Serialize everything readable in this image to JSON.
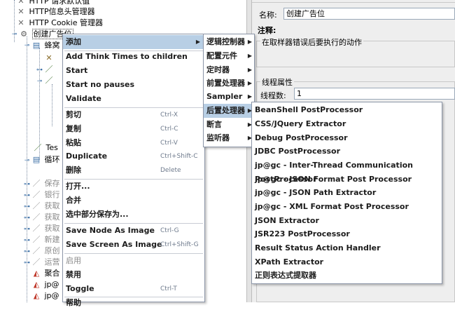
{
  "tree": {
    "items": [
      {
        "label": "HTTP 请求默认值"
      },
      {
        "label": "HTTP信息头管理器"
      },
      {
        "label": "HTTP Cookie 管理器"
      },
      {
        "label": "创建广告位"
      },
      {
        "label": "蜂窝"
      },
      {
        "label": "Tes"
      },
      {
        "label": "循环"
      },
      {
        "label": "保存"
      },
      {
        "label": "银行"
      },
      {
        "label": "获取"
      },
      {
        "label": "获取"
      },
      {
        "label": "获取"
      },
      {
        "label": "新建"
      },
      {
        "label": "原创"
      },
      {
        "label": "运营"
      },
      {
        "label": "聚合"
      },
      {
        "label": "jp@"
      },
      {
        "label": "jp@"
      }
    ]
  },
  "right_panel": {
    "name_label": "名称:",
    "name_value": "创建广告位",
    "comment_label": "注释:",
    "error_action_title": "在取样器错误后要执行的动作",
    "thread_props_title": "线程属性",
    "threads_label": "线程数:",
    "threads_value": "1"
  },
  "context_menu": {
    "add": "添加",
    "add_think_times": "Add Think Times to children",
    "start": "Start",
    "start_no_pauses": "Start no pauses",
    "validate": "Validate",
    "cut": "剪切",
    "cut_sc": "Ctrl-X",
    "copy": "复制",
    "copy_sc": "Ctrl-C",
    "paste": "粘贴",
    "paste_sc": "Ctrl-V",
    "duplicate": "Duplicate",
    "duplicate_sc": "Ctrl+Shift-C",
    "delete": "删除",
    "delete_sc": "Delete",
    "open": "打开...",
    "merge": "合并",
    "save_selection": "选中部分保存为...",
    "save_node_image": "Save Node As Image",
    "save_node_image_sc": "Ctrl-G",
    "save_screen_image": "Save Screen As Image",
    "save_screen_image_sc": "Ctrl+Shift-G",
    "enable": "启用",
    "disable": "禁用",
    "toggle": "Toggle",
    "toggle_sc": "Ctrl-T",
    "help": "帮助"
  },
  "add_submenu": {
    "logic_controller": "逻辑控制器",
    "config_element": "配置元件",
    "timer": "定时器",
    "pre_processor": "前置处理器",
    "sampler": "Sampler",
    "post_processor": "后置处理器",
    "assertion": "断言",
    "listener": "监听器"
  },
  "post_submenu": {
    "items": [
      "BeanShell PostProcessor",
      "CSS/JQuery Extractor",
      "Debug PostProcessor",
      "JDBC PostProcessor",
      "jp@gc - Inter-Thread Communication PostProcessor",
      "jp@gc - JSON Format Post Processor",
      "jp@gc - JSON Path Extractor",
      "jp@gc - XML Format Post Processor",
      "JSON Extractor",
      "JSR223 PostProcessor",
      "Result Status Action Handler",
      "XPath Extractor",
      "正则表达式提取器"
    ]
  },
  "colors": {
    "highlight": "#b8cfe5",
    "shortcut": "#6e7a8c",
    "disabled": "#8a8a8a"
  }
}
